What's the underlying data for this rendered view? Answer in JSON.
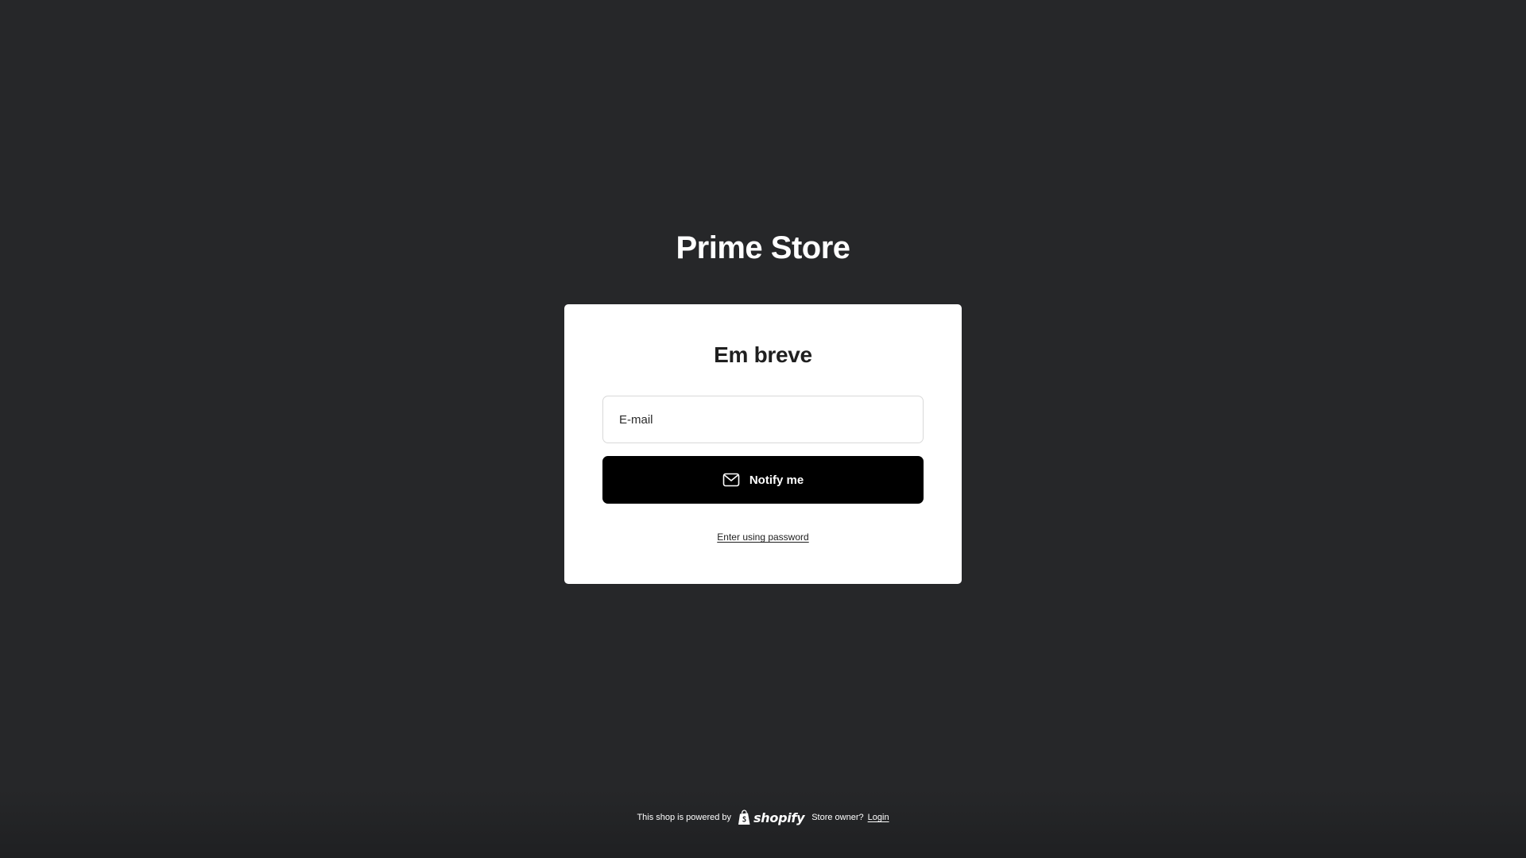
{
  "store": {
    "title": "Prime Store"
  },
  "card": {
    "heading": "Em breve",
    "email_placeholder": "E-mail",
    "email_value": "",
    "notify_label": "Notify me",
    "notify_icon": "mail-icon",
    "password_link": "Enter using password"
  },
  "footer": {
    "powered_by": "This shop is powered by",
    "brand": "shopify",
    "store_owner": "Store owner?",
    "login": "Login"
  },
  "colors": {
    "background": "#262729",
    "card": "#ffffff",
    "button": "#000000",
    "text_dark": "#1f1f1f",
    "text_light": "#ffffff"
  }
}
